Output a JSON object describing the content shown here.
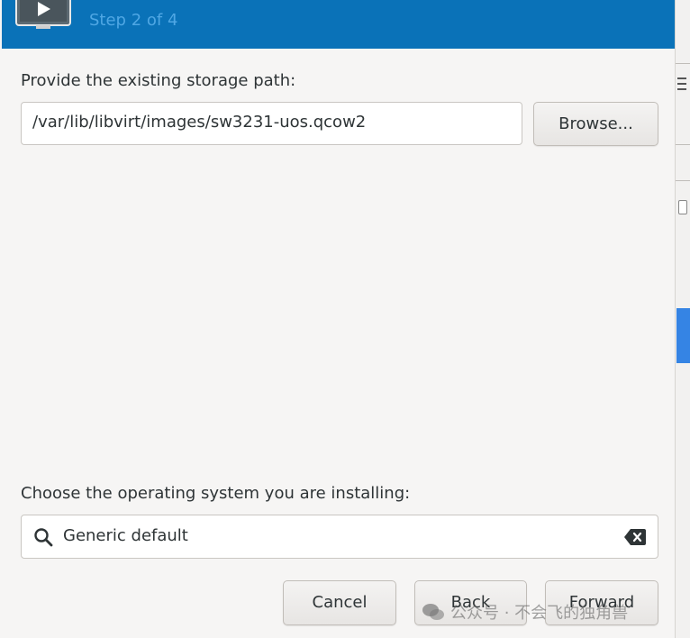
{
  "header": {
    "step_text": "Step 2 of 4",
    "background_color": "#0a72b8"
  },
  "storage": {
    "label": "Provide the existing storage path:",
    "path_value": "/var/lib/libvirt/images/sw3231-uos.qcow2",
    "browse_label": "Browse..."
  },
  "os": {
    "label": "Choose the operating system you are installing:",
    "search_value": "Generic default",
    "search_icon": "search-icon",
    "clear_icon": "clear-icon"
  },
  "footer": {
    "cancel_label": "Cancel",
    "back_label": "Back",
    "forward_label": "Forward"
  },
  "watermark": {
    "text": "公众号 · 不会飞的独角兽"
  },
  "colors": {
    "accent_blue": "#3584e4",
    "step_text": "#4fa7e4"
  }
}
